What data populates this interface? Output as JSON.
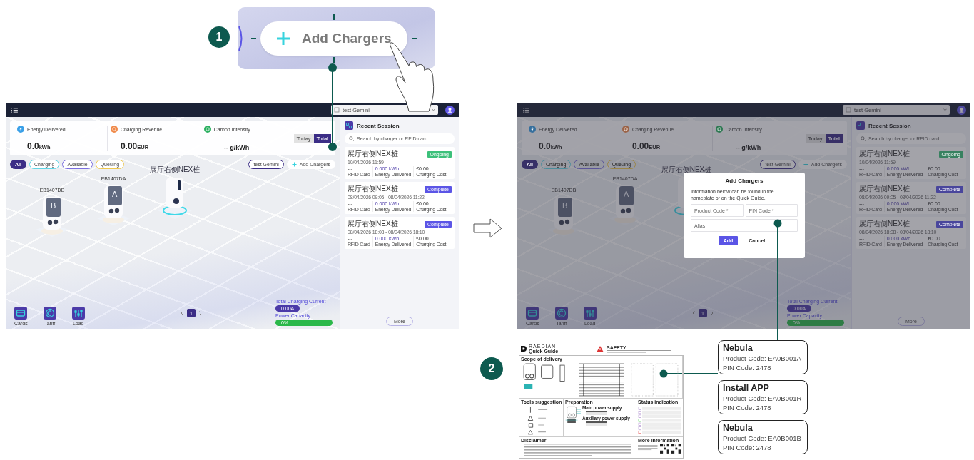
{
  "callout_1": {
    "number": "1",
    "button": {
      "label": "Add Chargers"
    }
  },
  "screens": [
    {
      "user_select": "test Gemini",
      "stats": [
        {
          "label": "Energy Delivered",
          "value": "0.0",
          "unit": "kWh",
          "kind": "energy",
          "color": "#3aa0e8"
        },
        {
          "label": "Charging Revenue",
          "value": "0.00",
          "unit": "EUR",
          "kind": "revenue",
          "color": "#f08a4b"
        },
        {
          "label": "Carbon Intensity",
          "value": "-- g/kWh",
          "kind": "carbon",
          "color": "#2bb060"
        }
      ],
      "period_tabs": [
        {
          "label": "Today",
          "selected": false
        },
        {
          "label": "Total",
          "selected": true
        }
      ],
      "filters": [
        {
          "label": "All",
          "selected": true,
          "color": "#3b2d86"
        },
        {
          "label": "Charging",
          "selected": false,
          "color": "#5fd6e6"
        },
        {
          "label": "Available",
          "selected": false,
          "color": "#7b6ee0"
        },
        {
          "label": "Queuing",
          "selected": false,
          "color": "#f0c84a"
        }
      ],
      "site_chip": "test Gemini",
      "add_button": "Add Chargers",
      "chargers": [
        {
          "name": "EB1407DB",
          "letter": "B",
          "kind": "dual"
        },
        {
          "name": "EB1407DA",
          "letter": "A",
          "kind": "dual"
        },
        {
          "name": "展厅右侧NEX桩",
          "kind": "single"
        }
      ],
      "tools": [
        {
          "label": "Cards",
          "kind": "card"
        },
        {
          "label": "Tariff",
          "kind": "tariff"
        },
        {
          "label": "Load",
          "kind": "load"
        }
      ],
      "pages": [
        {
          "label": "1",
          "selected": true
        }
      ],
      "current": {
        "label": "Total Charging Current",
        "value": "0.00A"
      },
      "capacity": {
        "label": "Power Capacity",
        "value": "0%"
      },
      "recent": {
        "title": "Recent Session",
        "search_placeholder": "Search by charger or RFID card",
        "more": "More",
        "sessions": [
          {
            "charger": "展厅右侧NEX桩",
            "time": "10/04/2026 11:59 -",
            "status": "Ongoing",
            "color": "#3cc07a",
            "card": "---",
            "card_label": "RFID Card",
            "energy": "0.000",
            "energy_unit": "kWh",
            "energy_label": "Energy Delivered",
            "cost": "€0.00",
            "cost_label": "Charging Cost"
          },
          {
            "charger": "展厅右侧NEX桩",
            "time": "08/04/2026 09:05 - 08/04/2026 11:22",
            "status": "Complete",
            "color": "#5b55e6",
            "card": "---",
            "card_label": "RFID Card",
            "energy": "0.000",
            "energy_unit": "kWh",
            "energy_label": "Energy Delivered",
            "cost": "€0.00",
            "cost_label": "Charging Cost"
          },
          {
            "charger": "展厅右侧NEX桩",
            "time": "08/04/2026 18:08 - 08/04/2026 18:10",
            "status": "Complete",
            "color": "#5b55e6",
            "card": "---",
            "card_label": "RFID Card",
            "energy": "0.000",
            "energy_unit": "kWh",
            "energy_label": "Energy Delivered",
            "cost": "€0.00",
            "cost_label": "Charging Cost"
          }
        ]
      }
    },
    {
      "user_select": "test Gemini",
      "stats": [
        {
          "label": "Energy Delivered",
          "value": "0.0",
          "unit": "kWh",
          "kind": "energy",
          "color": "#366f9d"
        },
        {
          "label": "Charging Revenue",
          "value": "0.00",
          "unit": "EUR",
          "kind": "revenue",
          "color": "#9b6347"
        },
        {
          "label": "Carbon Intensity",
          "value": "-- g/kWh",
          "kind": "carbon",
          "color": "#2e7852"
        }
      ],
      "period_tabs": [
        {
          "label": "Today",
          "selected": false
        },
        {
          "label": "Total",
          "selected": true
        }
      ],
      "filters": [
        {
          "label": "All",
          "selected": true,
          "color": "#373067"
        },
        {
          "label": "Charging",
          "selected": false,
          "color": "#4b8d9c"
        },
        {
          "label": "Available",
          "selected": false,
          "color": "#5a5498"
        },
        {
          "label": "Queuing",
          "selected": false,
          "color": "#9b8546"
        }
      ],
      "site_chip": "test Gemini",
      "add_button": "Add Chargers",
      "chargers": [
        {
          "name": "EB1407DB",
          "letter": "B",
          "kind": "dual"
        },
        {
          "name": "EB1407DA",
          "letter": "A",
          "kind": "dual"
        },
        {
          "name": "展厅右侧NEX桩",
          "kind": "single"
        }
      ],
      "tools": [
        {
          "label": "Cards",
          "kind": "card"
        },
        {
          "label": "Tariff",
          "kind": "tariff"
        },
        {
          "label": "Load",
          "kind": "load"
        }
      ],
      "pages": [
        {
          "label": "1",
          "selected": true
        }
      ],
      "current": {
        "label": "Total Charging Current",
        "value": "0.00A"
      },
      "capacity": {
        "label": "Power Capacity",
        "value": "0%"
      },
      "recent": {
        "title": "Recent Session",
        "search_placeholder": "Search by charger or RFID card",
        "more": "More",
        "sessions": [
          {
            "charger": "展厅右侧NEX桩",
            "time": "10/04/2026 11:59 -",
            "status": "Ongoing",
            "color": "#388160",
            "card": "---",
            "card_label": "RFID Card",
            "energy": "0.000",
            "energy_unit": "kWh",
            "energy_label": "Energy Delivered",
            "cost": "€0.00",
            "cost_label": "Charging Cost"
          },
          {
            "charger": "展厅右侧NEX桩",
            "time": "08/04/2026 09:05 - 08/04/2026 11:22",
            "status": "Complete",
            "color": "#49469c",
            "card": "---",
            "card_label": "RFID Card",
            "energy": "0.000",
            "energy_unit": "kWh",
            "energy_label": "Energy Delivered",
            "cost": "€0.00",
            "cost_label": "Charging Cost"
          },
          {
            "charger": "展厅右侧NEX桩",
            "time": "08/04/2026 18:08 - 08/04/2026 18:10",
            "status": "Complete",
            "color": "#49469c",
            "card": "---",
            "card_label": "RFID Card",
            "energy": "0.000",
            "energy_unit": "kWh",
            "energy_label": "Energy Delivered",
            "cost": "€0.00",
            "cost_label": "Charging Cost"
          }
        ]
      },
      "dialog": {
        "title": "Add Chargers",
        "info": "Information below can be found in the nameplate or on the Quick Guide.",
        "fields": [
          {
            "placeholder": "Product Code *"
          },
          {
            "placeholder": "PIN Code *"
          },
          {
            "placeholder": "Alias"
          }
        ],
        "buttons": [
          {
            "label": "Add",
            "kind": "primary"
          },
          {
            "label": "Cancel",
            "kind": "text"
          }
        ]
      }
    }
  ],
  "callout_2": {
    "number": "2"
  },
  "quick_guide": {
    "brand": "RAEDIAN",
    "subtitle": "Quick Guide",
    "safety": "SAFETY",
    "sections": [
      {
        "title": "Scope of delivery",
        "kind": "delivery"
      },
      {
        "title": "Tools suggestion",
        "kind": "tools"
      },
      {
        "title": "Preparation",
        "kind": "preparation",
        "subtitles": [
          "Main power supply",
          "Auxiliary power supply"
        ]
      },
      {
        "title": "Status indication",
        "kind": "status"
      },
      {
        "title": "Disclaimer",
        "kind": "text"
      },
      {
        "title": "More information",
        "kind": "qr"
      }
    ]
  },
  "product_cards": [
    {
      "title": "Nebula",
      "product_code": "Product Code: EA0B001A",
      "pin_code": "PIN Code: 2478"
    },
    {
      "title": "Install APP",
      "product_code": "Product Code: EA0B001R",
      "pin_code": "PIN Code: 2478"
    },
    {
      "title": "Nebula",
      "product_code": "Product Code: EA0B001B",
      "pin_code": "PIN Code: 2478"
    }
  ]
}
